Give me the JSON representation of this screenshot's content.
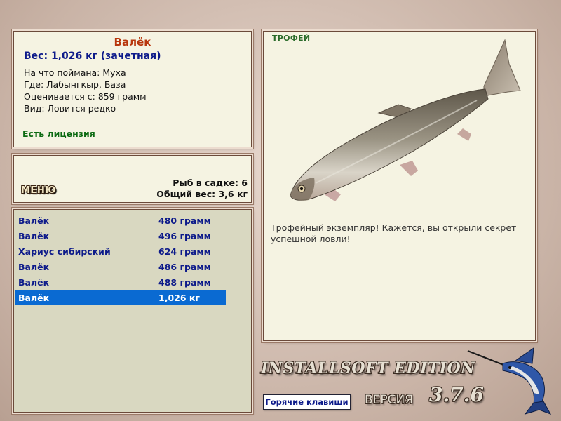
{
  "fish_card": {
    "name": "Валёк",
    "weight": "Вес: 1,026 кг (зачетная)",
    "caught_on": "На что поймана: Муха",
    "location": "Где: Лабынгкыр, База",
    "valued_from": "Оценивается с: 859 грамм",
    "rarity": "Вид: Ловится редко",
    "license": "Есть лицензия"
  },
  "menu": {
    "label": "МЕНЮ",
    "fish_in_keep": "Рыб в садке: 6",
    "total_weight": "Общий вес: 3,6 кг"
  },
  "catch_list": [
    {
      "name": "Валёк",
      "weight": "480 грамм"
    },
    {
      "name": "Валёк",
      "weight": "496 грамм"
    },
    {
      "name": "Хариус сибирский",
      "weight": "624 грамм"
    },
    {
      "name": "Валёк",
      "weight": "486 грамм"
    },
    {
      "name": "Валёк",
      "weight": "488 грамм"
    },
    {
      "name": "Валёк",
      "weight": "1,026 кг"
    }
  ],
  "selected_index": 5,
  "trophy": {
    "label": "ТРОФЕЙ",
    "text": "Трофейный экземпляр! Кажется, вы открыли секрет успешной ловли!",
    "image_icon": "whitefish-illustration"
  },
  "footer": {
    "hotkeys_label": "Горячие клавиши",
    "edition": "INSTALLSOFT EDITION",
    "version_label": "ВЕРСИЯ",
    "version_number": "3.7.6",
    "logo_icon": "marlin-logo"
  },
  "colors": {
    "fish_name": "#b8360c",
    "weight_text": "#0d1a8a",
    "license_text": "#0c6a12",
    "selection": "#0a6ad2",
    "panel_bg": "#f5f3e2",
    "list_bg": "#d9d8c1"
  }
}
